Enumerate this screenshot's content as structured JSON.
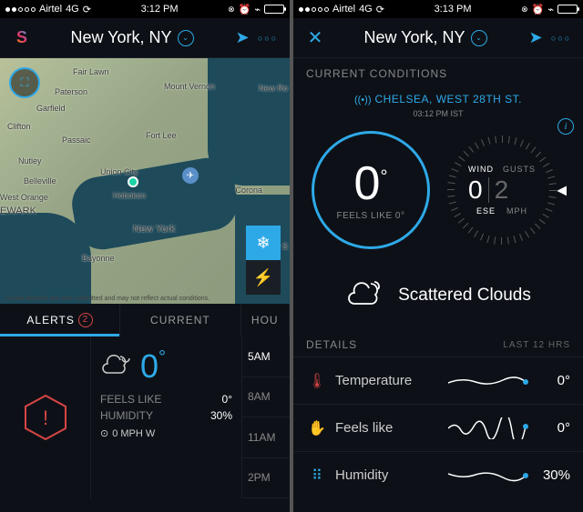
{
  "left": {
    "status": {
      "carrier": "Airtel",
      "network": "4G",
      "time": "3:12 PM"
    },
    "header": {
      "city": "New York, NY"
    },
    "map": {
      "labels": {
        "fairlawn": "Fair Lawn",
        "paterson": "Paterson",
        "garfield": "Garfield",
        "clifton": "Clifton",
        "passaic": "Passaic",
        "nutley": "Nutley",
        "belleville": "Belleville",
        "worange": "West Orange",
        "newark": "EWARK",
        "mtvernon": "Mount Vernon",
        "newroc": "New Ro",
        "fortlee": "Fort Lee",
        "unioncity": "Union City",
        "hoboken": "Hoboken",
        "nyc": "New York",
        "bayonne": "Bayonne",
        "corona": "Corona",
        "valleys": "Valley S"
      },
      "disclaimer": "Crowd Reports are user submitted and may not reflect actual conditions."
    },
    "tabs": {
      "alerts": "ALERTS",
      "alerts_count": "2",
      "current": "CURRENT",
      "hourly": "HOU"
    },
    "current": {
      "temp": "0",
      "feels_label": "FEELS LIKE",
      "feels_val": "0°",
      "humidity_label": "HUMIDITY",
      "humidity_val": "30%",
      "wind": "0 MPH W"
    },
    "hours": [
      "5AM",
      "8AM",
      "11AM",
      "2PM"
    ]
  },
  "right": {
    "status": {
      "carrier": "Airtel",
      "network": "4G",
      "time": "3:13 PM"
    },
    "header": {
      "city": "New York, NY"
    },
    "section_current": "CURRENT CONDITIONS",
    "location": {
      "name": "CHELSEA, WEST 28TH ST.",
      "time": "03:12 PM IST"
    },
    "temp": "0",
    "feels": "FEELS LIKE 0°",
    "wind": {
      "wind_lbl": "WIND",
      "gusts_lbl": "GUSTS",
      "wind_val": "0",
      "gusts_val": "2",
      "dir": "ESE",
      "unit": "MPH"
    },
    "description": "Scattered Clouds",
    "section_details": "DETAILS",
    "section_details_sub": "LAST 12 HRS",
    "details": {
      "temp_label": "Temperature",
      "temp_val": "0°",
      "feel_label": "Feels like",
      "feel_val": "0°",
      "hum_label": "Humidity",
      "hum_val": "30%"
    }
  }
}
